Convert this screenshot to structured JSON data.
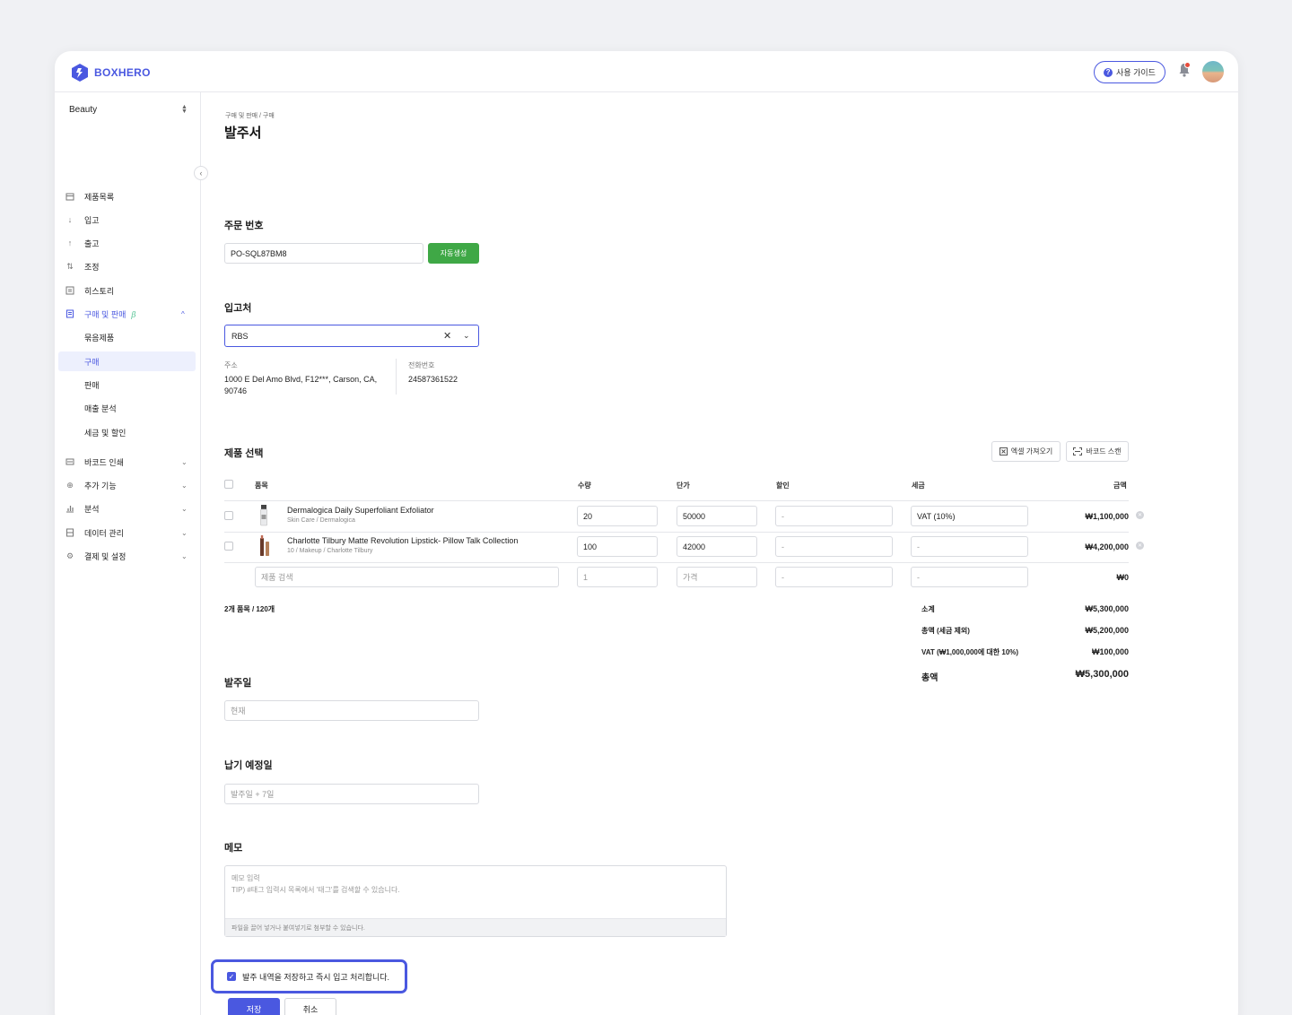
{
  "app": {
    "brand": "BOXHERO"
  },
  "header": {
    "guide_label": "사용 가이드",
    "guide_icon": "question-icon"
  },
  "sidebar": {
    "workspace": "Beauty",
    "items": [
      {
        "label": "제품목록",
        "icon": "box-icon"
      },
      {
        "label": "입고",
        "icon": "arrow-down-icon"
      },
      {
        "label": "출고",
        "icon": "arrow-up-icon"
      },
      {
        "label": "조정",
        "icon": "swap-icon"
      },
      {
        "label": "히스토리",
        "icon": "history-icon"
      },
      {
        "label": "구매 및 판매",
        "icon": "document-icon",
        "badge": "β"
      },
      {
        "label": "묶음제품"
      },
      {
        "label": "구매"
      },
      {
        "label": "판매"
      },
      {
        "label": "매출 분석"
      },
      {
        "label": "세금 및 할인"
      },
      {
        "label": "바코드 인쇄",
        "icon": "barcode-icon"
      },
      {
        "label": "추가 기능",
        "icon": "plus-circle-icon"
      },
      {
        "label": "분석",
        "icon": "chart-icon"
      },
      {
        "label": "데이터 관리",
        "icon": "database-icon"
      },
      {
        "label": "결제 및 설정",
        "icon": "gear-icon"
      }
    ]
  },
  "page": {
    "breadcrumb": "구매 및 판매 / 구매",
    "title": "발주서",
    "order": {
      "label": "주문 번호",
      "value": "PO-SQL87BM8",
      "auto_btn": "자동생성"
    },
    "supplier": {
      "label": "입고처",
      "value": "RBS",
      "address_label": "주소",
      "address_line1": "1000 E Del Amo Blvd, F12***, Carson, CA,",
      "address_line2": "90746",
      "phone_label": "전화번호",
      "phone": "24587361522"
    },
    "products": {
      "label": "제품 선택",
      "excel_btn": "엑셀 가져오기",
      "barcode_btn": "바코드 스캔",
      "columns": {
        "item": "품목",
        "qty": "수량",
        "price": "단가",
        "discount": "할인",
        "tax": "세금",
        "amount": "금액"
      },
      "rows": [
        {
          "name": "Dermalogica Daily Superfoliant Exfoliator",
          "sub": "Skin Care / Dermalogica",
          "qty": "20",
          "price": "50000",
          "discount": "-",
          "tax": "VAT (10%)",
          "amount": "₩1,100,000"
        },
        {
          "name": "Charlotte Tilbury Matte Revolution Lipstick- Pillow Talk Collection",
          "sub": "10 / Makeup / Charlotte Tilbury",
          "qty": "100",
          "price": "42000",
          "discount": "-",
          "tax": "-",
          "amount": "₩4,200,000"
        }
      ],
      "new_row": {
        "search_placeholder": "제품 검색",
        "qty": "1",
        "price_placeholder": "가격",
        "discount": "-",
        "tax": "-",
        "amount": "₩0"
      },
      "count_summary": "2개 품목 / 120개"
    },
    "summary": {
      "subtotal_label": "소계",
      "subtotal": "₩5,300,000",
      "pretax_label": "총액 (세금 제외)",
      "pretax": "₩5,200,000",
      "vat_label": "VAT (₩1,000,000에 대한 10%)",
      "vat": "₩100,000",
      "total_label": "총액",
      "total": "₩5,300,000"
    },
    "order_date": {
      "label": "발주일",
      "placeholder": "현재"
    },
    "delivery_date": {
      "label": "납기 예정일",
      "placeholder": "발주일 + 7일"
    },
    "memo": {
      "label": "메모",
      "placeholder_line1": "메모 입력",
      "placeholder_line2": "TIP) #태그 입력시 목록에서 '태그'를 검색할 수 있습니다.",
      "footer": "파일을 끌어 넣거나 붙여넣기로 첨부할 수 있습니다."
    },
    "confirm_text": "발주 내역을 저장하고 즉시 입고 처리합니다.",
    "save_btn": "저장",
    "cancel_btn": "취소"
  },
  "colors": {
    "accent": "#4a58e0",
    "green": "#3fa846",
    "beta": "#5ec79a"
  }
}
